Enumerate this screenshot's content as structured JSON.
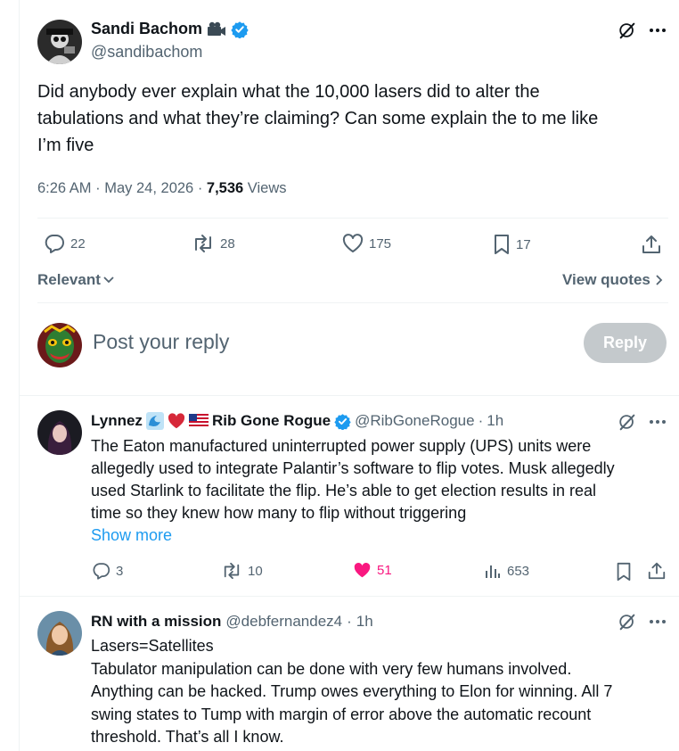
{
  "tweet": {
    "author_name": "Sandi Bachom",
    "author_handle": "@sandibachom",
    "text_lines": [
      "Did anybody ever explain what the 10,000 lasers  did to alter the",
      "tabulations and what they’re claiming? Can some explain the to me like",
      "I’m five"
    ],
    "time": "6:26 AM",
    "date": "May 24, 2026",
    "views_count": "7,536",
    "views_label": "Views",
    "replies": "22",
    "reposts": "28",
    "likes": "175",
    "bookmarks": "17",
    "sort_label": "Relevant",
    "view_quotes_label": "View quotes"
  },
  "composer": {
    "placeholder": "Post your reply",
    "reply_button": "Reply"
  },
  "replies": [
    {
      "name_prefix": "Lynnez",
      "name_suffix": "Rib Gone Rogue",
      "handle": "@RibGoneRogue",
      "time": "1h",
      "text_lines": [
        "The Eaton manufactured uninterrupted power supply (UPS) units were",
        "allegedly used to integrate Palantir’s software to flip votes. Musk allegedly",
        "used Starlink to facilitate the flip. He’s able to get election results in real",
        "time so they knew how many to flip without triggering"
      ],
      "show_more": "Show more",
      "replies": "3",
      "reposts": "10",
      "likes": "51",
      "views": "653"
    },
    {
      "name": "RN with a mission",
      "handle": "@debfernandez4",
      "time": "1h",
      "text_lines": [
        "Lasers=Satellites",
        "Tabulator manipulation can be done with very few humans involved.",
        "Anything can be hacked. Trump owes everything to Elon for winning. All 7",
        "swing states to Tump with margin of error above the automatic recount",
        "threshold.  That’s all I know."
      ]
    }
  ],
  "colors": {
    "accent": "#1d9bf0",
    "like_active": "#f91880",
    "secondary_text": "#536471",
    "reply_disabled": "#c4c9cc"
  }
}
